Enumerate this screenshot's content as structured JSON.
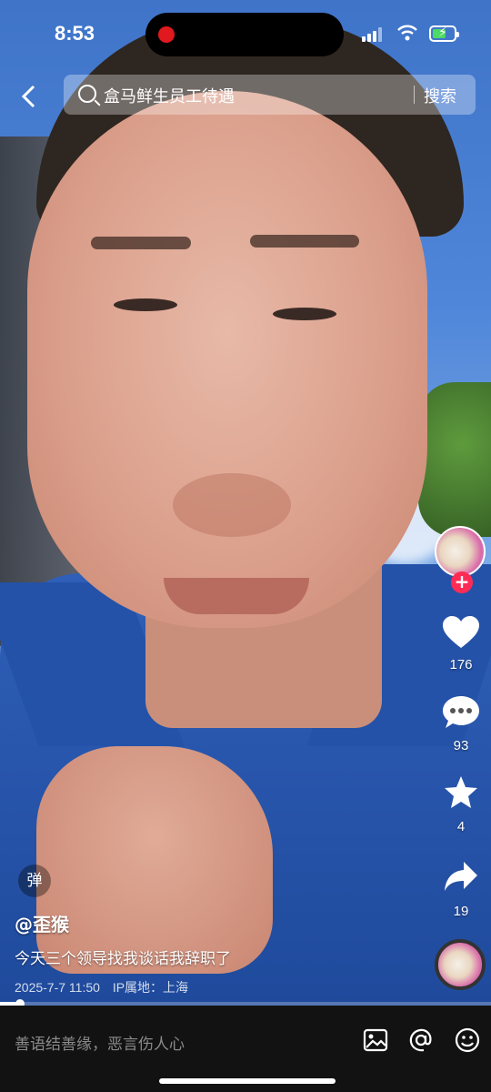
{
  "status_bar": {
    "time": "8:53"
  },
  "search": {
    "query": "盒马鲜生员工待遇",
    "button_label": "搜索"
  },
  "actions": {
    "likes": "176",
    "comments": "93",
    "favorites": "4",
    "shares": "19",
    "follow_symbol": "+"
  },
  "video": {
    "danmu_label": "弹",
    "author": "@歪猴",
    "caption": "今天三个领导找我谈话我辞职了",
    "date": "2025-7-7 11:50",
    "ip_location": "IP属地：上海",
    "progress": 0.04
  },
  "comment_bar": {
    "placeholder": "善语结善缘，恶言伤人心"
  },
  "colors": {
    "follow": "#fe2c55",
    "progress": "#ffffff",
    "bottom_bg": "#121212"
  },
  "icons": [
    "back-icon",
    "search-icon",
    "heart-icon",
    "comment-icon",
    "star-icon",
    "share-icon",
    "image-icon",
    "at-icon",
    "emoji-icon"
  ]
}
